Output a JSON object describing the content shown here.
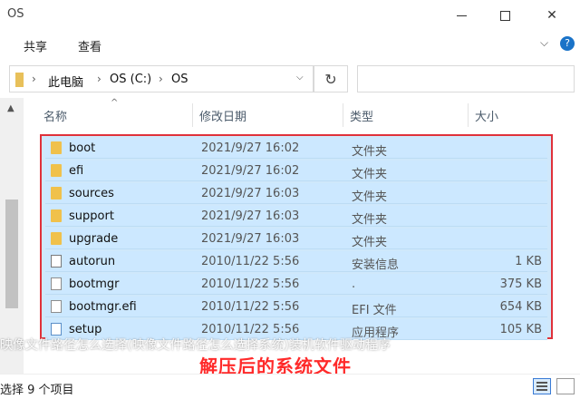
{
  "window": {
    "title": "OS"
  },
  "ribbon": {
    "tabs": [
      "共享",
      "查看"
    ]
  },
  "address": {
    "crumbs": [
      "此电脑",
      "OS (C:)",
      "OS"
    ]
  },
  "columns": {
    "name": "名称",
    "date": "修改日期",
    "type": "类型",
    "size": "大小"
  },
  "files": [
    {
      "name": "boot",
      "date": "2021/9/27 16:02",
      "type": "文件夹",
      "size": "",
      "icon": "folder-icon"
    },
    {
      "name": "efi",
      "date": "2021/9/27 16:02",
      "type": "文件夹",
      "size": "",
      "icon": "folder-icon"
    },
    {
      "name": "sources",
      "date": "2021/9/27 16:03",
      "type": "文件夹",
      "size": "",
      "icon": "folder-icon"
    },
    {
      "name": "support",
      "date": "2021/9/27 16:03",
      "type": "文件夹",
      "size": "",
      "icon": "folder-icon"
    },
    {
      "name": "upgrade",
      "date": "2021/9/27 16:03",
      "type": "文件夹",
      "size": "",
      "icon": "folder-icon"
    },
    {
      "name": "autorun",
      "date": "2010/11/22 5:56",
      "type": "安装信息",
      "size": "1 KB",
      "icon": "autorun-icon"
    },
    {
      "name": "bootmgr",
      "date": "2010/11/22 5:56",
      "type": ".",
      "size": "375 KB",
      "icon": "file-icon"
    },
    {
      "name": "bootmgr.efi",
      "date": "2010/11/22 5:56",
      "type": "EFI 文件",
      "size": "654 KB",
      "icon": "file-icon"
    },
    {
      "name": "setup",
      "date": "2010/11/22 5:56",
      "type": "应用程序",
      "size": "105 KB",
      "icon": "setup-icon"
    }
  ],
  "overlay": {
    "caption": "映像文件路径怎么选择(映像文件路径怎么选择系统)装机软件驱动程序",
    "banner": "解压后的系统文件"
  },
  "status": {
    "text": "选择 9 个项目"
  },
  "colors": {
    "selection": "#cce8ff",
    "highlight_border": "#e0313a",
    "banner_text": "#ff2a2a"
  }
}
